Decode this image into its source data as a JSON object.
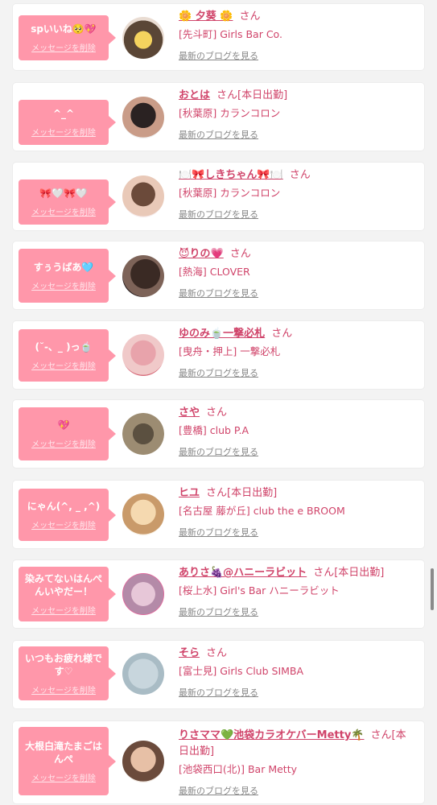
{
  "items": [
    {
      "message": "spいいね🥺💖",
      "delete": "メッセージを削除",
      "name": "🌼 夕葵 🌼",
      "san": "さん",
      "status": "",
      "shop": "[先斗町] Girls Bar Co.",
      "blog": "最新のブログを見る"
    },
    {
      "message": "^_^",
      "delete": "メッセージを削除",
      "name": "おとは",
      "san": "さん",
      "status": "[本日出勤]",
      "shop": "[秋葉原] カランコロン",
      "blog": "最新のブログを見る"
    },
    {
      "message": "🎀🤍🎀🤍",
      "delete": "メッセージを削除",
      "name": "🍽️🎀しきちゃん🎀🍽️",
      "san": "さん",
      "status": "",
      "shop": "[秋葉原] カランコロン",
      "blog": "最新のブログを見る"
    },
    {
      "message": "すぅうばあ🩵",
      "delete": "メッセージを削除",
      "name": "😈りの💗",
      "san": "さん",
      "status": "",
      "shop": "[熱海] CLOVER",
      "blog": "最新のブログを見る"
    },
    {
      "message": "(˘-、_ )っ🍵",
      "delete": "メッセージを削除",
      "name": "ゆのみ🍵一撃必札",
      "san": "さん",
      "status": "",
      "shop": "[曳舟・押上] 一撃必札",
      "blog": "最新のブログを見る"
    },
    {
      "message": "💖",
      "delete": "メッセージを削除",
      "name": "さや",
      "san": "さん",
      "status": "",
      "shop": "[豊橋] club P.A",
      "blog": "最新のブログを見る"
    },
    {
      "message": "にゃん(^,  _ ,^)",
      "delete": "メッセージを削除",
      "name": "ヒユ",
      "san": "さん",
      "status": "[本日出勤]",
      "shop": "[名古屋 藤が丘] club the e BROOM",
      "blog": "最新のブログを見る"
    },
    {
      "message": "染みてないはんぺんいやだー！",
      "delete": "メッセージを削除",
      "name": "ありさ🍇@ハニーラビット",
      "san": "さん",
      "status": "[本日出勤]",
      "shop": "[桜上水] Girl's Bar ハニーラビット",
      "blog": "最新のブログを見る"
    },
    {
      "message": "いつもお疲れ様です♡",
      "delete": "メッセージを削除",
      "name": "そら",
      "san": "さん",
      "status": "",
      "shop": "[富士見] Girls Club SIMBA",
      "blog": "最新のブログを見る"
    },
    {
      "message": "大根白滝たまごはんぺ",
      "delete": "メッセージを削除",
      "name": "りさママ💚池袋カラオケバーMetty🌴",
      "san": "さん",
      "status": "[本日出勤]",
      "shop": "[池袋西口(北)] Bar Metty",
      "blog": "最新のブログを見る"
    }
  ],
  "colors": {
    "accent_pink": "#ff97aa",
    "link_pink": "#d0446a",
    "background": "#f3f3f3"
  }
}
